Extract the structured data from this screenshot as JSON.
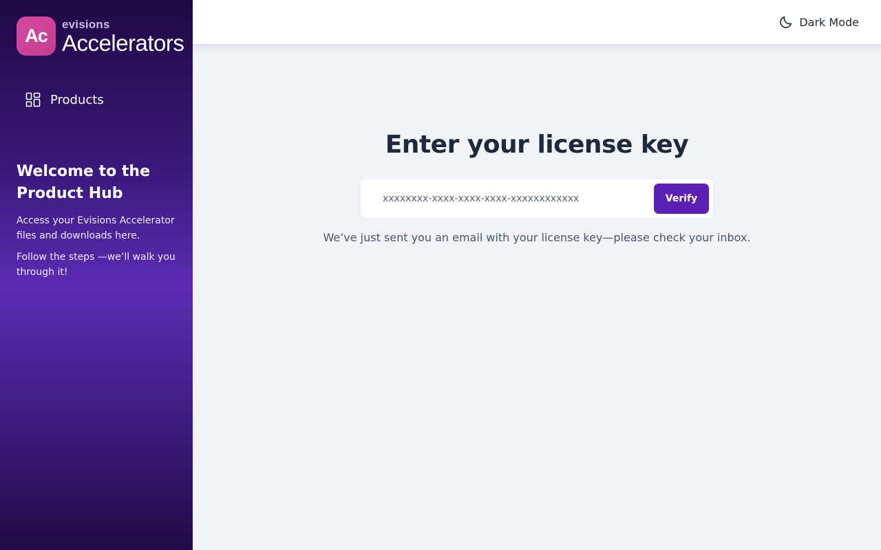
{
  "brand": {
    "badge": "Ac",
    "sub": "evisions",
    "name": "Accelerators"
  },
  "sidebar": {
    "nav": [
      {
        "label": "Products",
        "icon": "grid-dashboard-icon"
      }
    ],
    "welcome": {
      "title": "Welcome to the Product Hub",
      "line1": "Access your Evisions Accelerator files and downloads here.",
      "line2": "Follow the steps —we’ll walk you through it!"
    }
  },
  "topbar": {
    "dark_mode_label": "Dark Mode",
    "dark_mode_icon": "moon-icon"
  },
  "license": {
    "heading": "Enter your license key",
    "placeholder": "xxxxxxxx-xxxx-xxxx-xxxx-xxxxxxxxxxxx",
    "value": "",
    "verify_label": "Verify",
    "hint": "We’ve just sent you an email with your license key—please check your inbox."
  },
  "colors": {
    "accent": "#5b21b6",
    "sidebar_mid": "#5b2bb3",
    "sidebar_dark": "#1e0a45",
    "logo_pink": "#d64aa0",
    "main_bg": "#f0f3f8"
  }
}
